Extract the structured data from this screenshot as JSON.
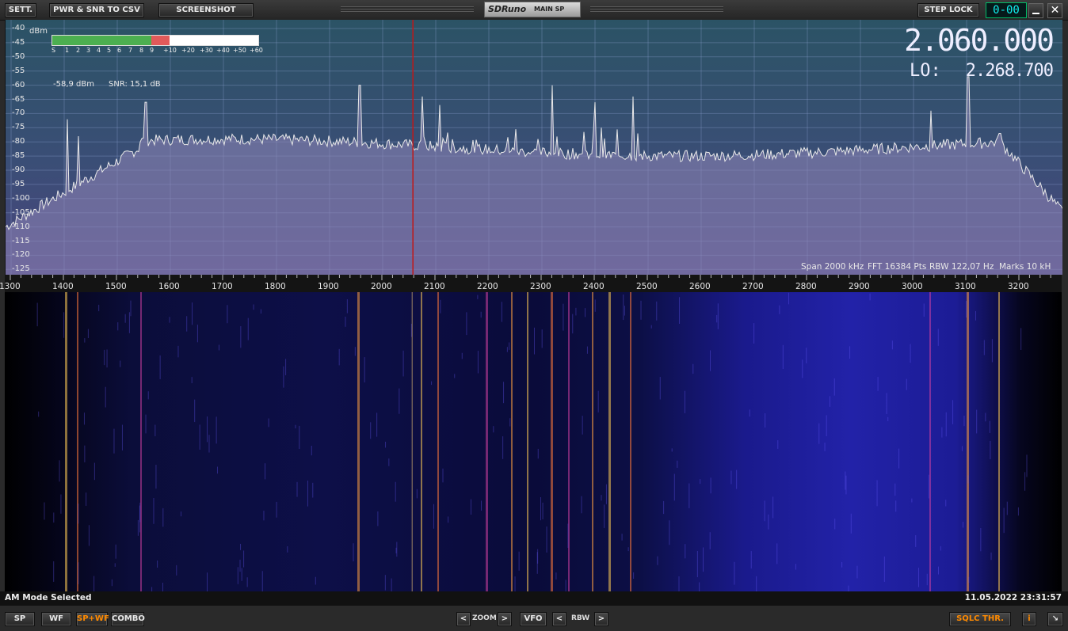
{
  "toolbar": {
    "settings_label": "SETT.",
    "csv_label": "PWR & SNR TO CSV",
    "screenshot_label": "SCREENSHOT",
    "app_name": "SDRuno",
    "window_name": "MAIN SP",
    "step_lock_label": "STEP LOCK",
    "display_value": "0-00",
    "minimize_icon": "minimize-icon",
    "close_icon": "close-icon"
  },
  "spectrum": {
    "unit": "dBm",
    "y_ticks": [
      "-40",
      "-45",
      "-50",
      "-55",
      "-60",
      "-65",
      "-70",
      "-75",
      "-80",
      "-85",
      "-90",
      "-95",
      "-100",
      "-105",
      "-110",
      "-115",
      "-120",
      "-125"
    ],
    "x_ticks": [
      "1300",
      "1400",
      "1500",
      "1600",
      "1700",
      "1800",
      "1900",
      "2000",
      "2100",
      "2200",
      "2300",
      "2400",
      "2500",
      "2600",
      "2700",
      "2800",
      "2900",
      "3000",
      "3100",
      "3200"
    ],
    "s_meter_labels": [
      "S",
      "1",
      "2",
      "3",
      "4",
      "5",
      "6",
      "7",
      "8",
      "9",
      "+10",
      "+20",
      "+30",
      "+40",
      "+50",
      "+60"
    ],
    "s_meter_level_dbm": -58.9,
    "power_readout": "-58,9 dBm",
    "snr_readout": "SNR: 15,1 dB",
    "frequency": "2.060.000",
    "lo_label": "LO:",
    "lo_frequency": "2.268.700",
    "span": "Span 2000 kHz",
    "fft": "FFT 16384 Pts",
    "rbw": "RBW 122,07 Hz",
    "marks": "Marks 10 kH",
    "colors": {
      "trace": "#e8e8e8",
      "fill": "#8f86b8",
      "cursor": "#c01818",
      "meter_green": "#4caf50",
      "meter_red": "#e05a5a"
    }
  },
  "status": {
    "mode": "AM Mode Selected",
    "datetime": "11.05.2022 23:31:57"
  },
  "bottom": {
    "sp_label": "SP",
    "wf_label": "WF",
    "spwf_label": "SP+WF",
    "combo_label": "COMBO",
    "zoom_label": "ZOOM",
    "vfo_label": "VFO",
    "rbw_label": "RBW",
    "sqlc_label": "SQLC THR.",
    "info_label": "i",
    "prev_glyph": "<",
    "next_glyph": ">",
    "resize_icon": "resize-icon"
  }
}
